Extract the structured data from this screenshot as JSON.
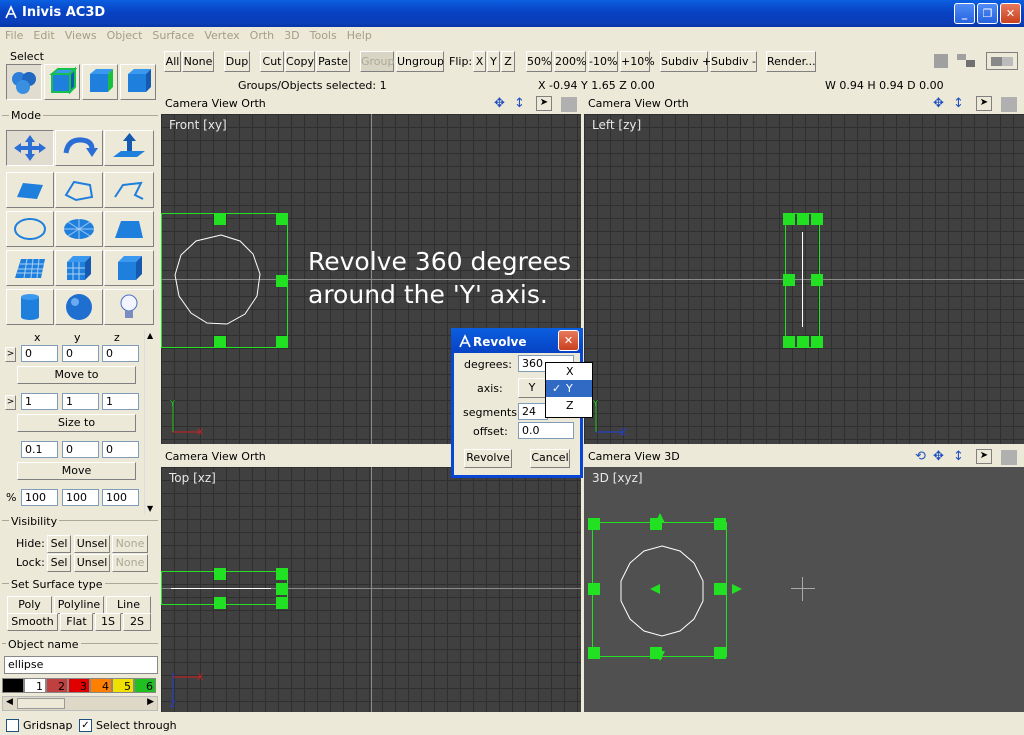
{
  "window": {
    "title": "Inivis AC3D"
  },
  "menu": [
    "File",
    "Edit",
    "Views",
    "Object",
    "Surface",
    "Vertex",
    "Orth",
    "3D",
    "Tools",
    "Help"
  ],
  "toolbar": {
    "all": "All",
    "none": "None",
    "dup": "Dup",
    "cut": "Cut",
    "copy": "Copy",
    "paste": "Paste",
    "group": "Group",
    "ungroup": "Ungroup",
    "flip_label": "Flip:",
    "x": "X",
    "y": "Y",
    "z": "Z",
    "z50": "50%",
    "z200": "200%",
    "m10": "-10%",
    "p10": "+10%",
    "subdiv_plus": "Subdiv +",
    "subdiv_minus": "Subdiv -",
    "render": "Render..."
  },
  "status": {
    "selected": "Groups/Objects selected: 1",
    "coords": "X -0.94 Y 1.65 Z 0.00",
    "dims": "W 0.94 H 0.94 D 0.00"
  },
  "left": {
    "select_label": "Select",
    "mode_label": "Mode",
    "xyz": {
      "x": "x",
      "y": "y",
      "z": "z"
    },
    "pos": [
      "0",
      "0",
      "0"
    ],
    "move_to": "Move to",
    "size": [
      "1",
      "1",
      "1"
    ],
    "size_to": "Size to",
    "move": [
      "0.1",
      "0",
      "0"
    ],
    "move_btn": "Move",
    "pct_label": "%",
    "pct": [
      "100",
      "100",
      "100"
    ],
    "visibility_label": "Visibility",
    "hide_label": "Hide:",
    "lock_label": "Lock:",
    "sel": "Sel",
    "unsel": "Unsel",
    "none": "None",
    "surface_label": "Set Surface type",
    "poly": "Poly",
    "polyline": "Polyline",
    "line": "Line",
    "smooth": "Smooth",
    "flat": "Flat",
    "s1": "1S",
    "s2": "2S",
    "objname_label": "Object name",
    "objname": "ellipse",
    "palette": [
      {
        "n": "",
        "c": "#000000"
      },
      {
        "n": "1",
        "c": "#ffffff"
      },
      {
        "n": "2",
        "c": "#c04040"
      },
      {
        "n": "3",
        "c": "#e00000"
      },
      {
        "n": "4",
        "c": "#ff8000"
      },
      {
        "n": "5",
        "c": "#f0e000"
      },
      {
        "n": "6",
        "c": "#20c020"
      }
    ]
  },
  "viewports": {
    "menu": {
      "camera": "Camera",
      "view": "View",
      "orth": "Orth",
      "v3d": "3D"
    },
    "front": "Front [xy]",
    "left": "Left [zy]",
    "top": "Top [xz]",
    "persp": "3D [xyz]"
  },
  "annotation": {
    "line1": "Revolve 360 degrees",
    "line2": "around the 'Y' axis."
  },
  "dialog": {
    "title": "Revolve",
    "degrees_label": "degrees:",
    "degrees": "360",
    "axis_label": "axis:",
    "axis": "Y",
    "segments_label": "segments:",
    "segments": "24",
    "offset_label": "offset:",
    "offset": "0.0",
    "revolve_btn": "Revolve",
    "cancel_btn": "Cancel",
    "options": [
      "X",
      "Y",
      "Z"
    ],
    "selected": "Y"
  },
  "bottom": {
    "gridsnap": "Gridsnap",
    "select_through": "Select through",
    "gridsnap_checked": false,
    "select_through_checked": true
  },
  "colors": {
    "selection": "#22e022",
    "viewport_bg": "#404040",
    "titlebar": "#0842c4"
  }
}
